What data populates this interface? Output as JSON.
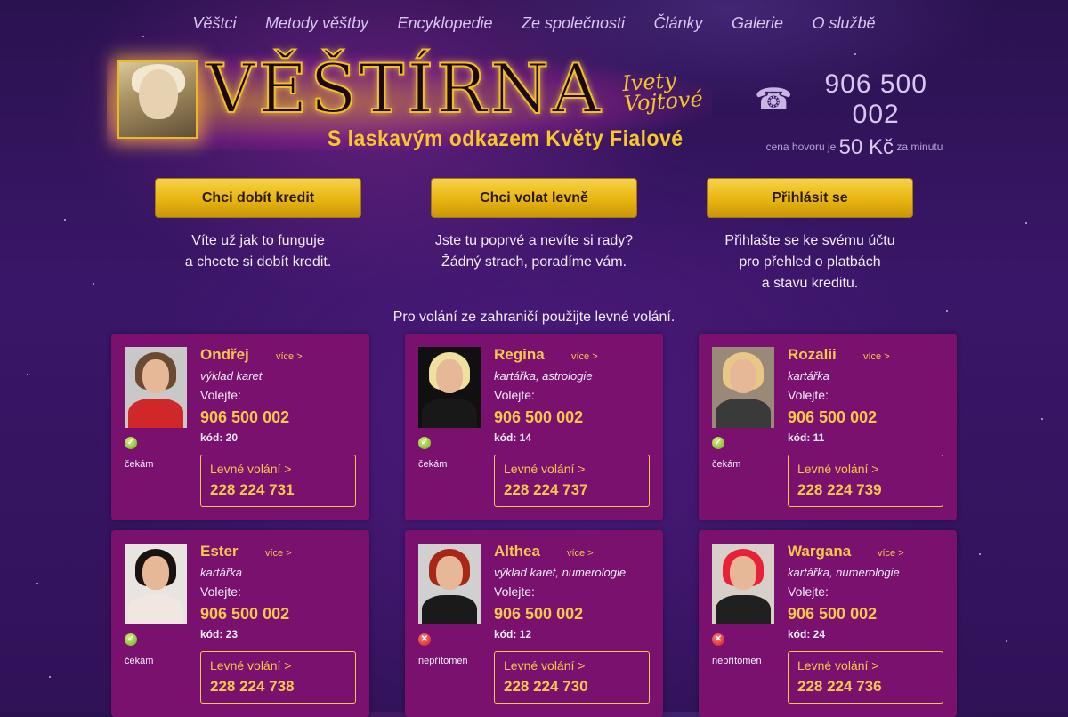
{
  "nav": [
    {
      "label": "Věštci"
    },
    {
      "label": "Metody věštby"
    },
    {
      "label": "Encyklopedie"
    },
    {
      "label": "Ze společnosti"
    },
    {
      "label": "Články"
    },
    {
      "label": "Galerie"
    },
    {
      "label": "O službě"
    }
  ],
  "logo": {
    "title": "VĚŠTÍRNA",
    "script_line1": "Ivety",
    "script_line2": "Vojtové",
    "subtitle": "S laskavým odkazem Květy Fialové"
  },
  "phone": {
    "icon": "telephone-icon",
    "number": "906 500 002",
    "price_prefix": "cena hovoru je",
    "price_value": "50 Kč",
    "price_suffix": "za minutu"
  },
  "cta": [
    {
      "button": "Chci dobít kredit",
      "line1": "Víte už jak to funguje",
      "line2": "a chcete si dobít kredit.",
      "line3": ""
    },
    {
      "button": "Chci volat levně",
      "line1": "Jste tu poprvé a nevíte si rady?",
      "line2": "Žádný strach, poradíme vám.",
      "line3": ""
    },
    {
      "button": "Přihlásit se",
      "line1": "Přihlašte se ke svému účtu",
      "line2": "pro přehled o platbách",
      "line3": "a stavu kreditu."
    }
  ],
  "foreign_note": "Pro volání ze zahraničí použijte levné volání.",
  "card_labels": {
    "more": "více >",
    "call": "Volejte:",
    "cheap": "Levné volání >"
  },
  "cards": [
    {
      "name": "Ondřej",
      "spec": "výklad karet",
      "number": "906 500 002",
      "code": "kód: 20",
      "status": "čekám",
      "status_icon": "online-check-icon",
      "cheap_number": "228 224 731",
      "colors": {
        "bg": "#c8c8c8",
        "hair": "#6a4a30",
        "body": "#d02828"
      }
    },
    {
      "name": "Regina",
      "spec": "kartářka, astrologie",
      "number": "906 500 002",
      "code": "kód: 14",
      "status": "čekám",
      "status_icon": "online-check-icon",
      "cheap_number": "228 224 737",
      "colors": {
        "bg": "#101010",
        "hair": "#f0e0a0",
        "body": "#181818"
      }
    },
    {
      "name": "Rozalii",
      "spec": "kartářka",
      "number": "906 500 002",
      "code": "kód: 11",
      "status": "čekám",
      "status_icon": "online-check-icon",
      "cheap_number": "228 224 739",
      "colors": {
        "bg": "#9a8878",
        "hair": "#e8c888",
        "body": "#3a3a3a"
      }
    },
    {
      "name": "Ester",
      "spec": "kartářka",
      "number": "906 500 002",
      "code": "kód: 23",
      "status": "čekám",
      "status_icon": "online-check-icon",
      "cheap_number": "228 224 738",
      "colors": {
        "bg": "#e8e4e0",
        "hair": "#1a1210",
        "body": "#f0e8e0"
      }
    },
    {
      "name": "Althea",
      "spec": "výklad karet, numerologie",
      "number": "906 500 002",
      "code": "kód: 12",
      "status": "nepřítomen",
      "status_icon": "offline-cross-icon",
      "cheap_number": "228 224 730",
      "colors": {
        "bg": "#d0d0d0",
        "hair": "#a82818",
        "body": "#1a1a1a"
      }
    },
    {
      "name": "Wargana",
      "spec": "kartářka, numerologie",
      "number": "906 500 002",
      "code": "kód: 24",
      "status": "nepřítomen",
      "status_icon": "offline-cross-icon",
      "cheap_number": "228 224 736",
      "colors": {
        "bg": "#d8d0c8",
        "hair": "#e8203a",
        "body": "#202020"
      }
    }
  ]
}
